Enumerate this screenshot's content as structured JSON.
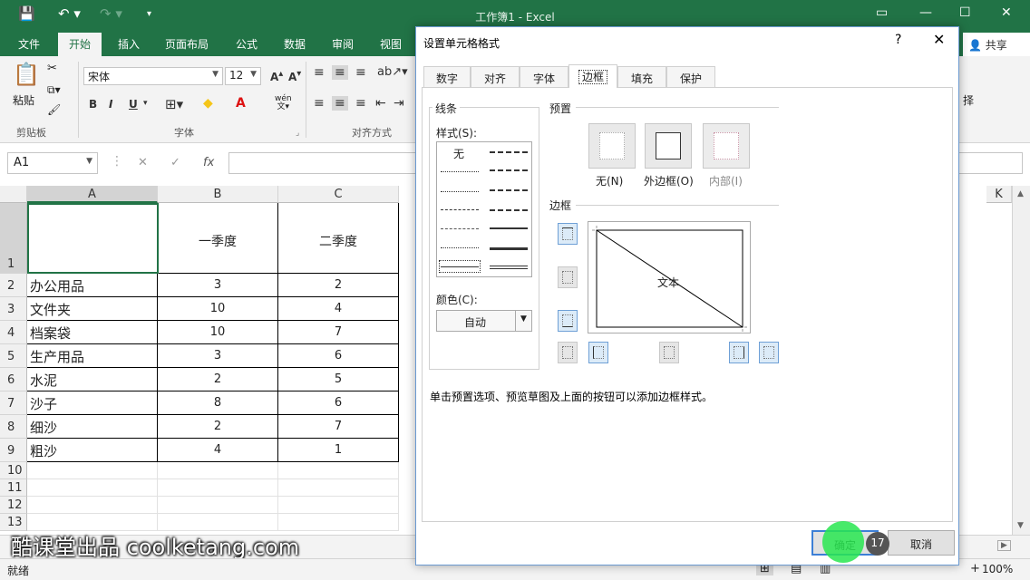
{
  "app": {
    "window_title": "工作簿1 - Excel"
  },
  "ribbon": {
    "tabs": [
      "文件",
      "开始",
      "插入",
      "页面布局",
      "公式",
      "数据",
      "审阅",
      "视图"
    ],
    "active_tab": "开始",
    "share_label": "共享",
    "font_name": "宋体",
    "font_size": "12",
    "paste_label": "粘贴",
    "group_clipboard": "剪贴板",
    "group_font": "字体",
    "group_alignment": "对齐方式",
    "partial_right_label": "择",
    "bold": "B",
    "italic": "I",
    "underline": "U",
    "wen": "wén"
  },
  "formula_bar": {
    "name_box": "A1",
    "fx": "fx",
    "cancel": "✕",
    "enter": "✓"
  },
  "sheet": {
    "columns": [
      "A",
      "B",
      "C"
    ],
    "partial_column_right": "K",
    "row_numbers": [
      "1",
      "2",
      "3",
      "4",
      "5",
      "6",
      "7",
      "8",
      "9",
      "10",
      "11",
      "12",
      "13"
    ],
    "header_row": [
      "",
      "一季度",
      "二季度"
    ],
    "rows": [
      [
        "办公用品",
        "3",
        "2"
      ],
      [
        "文件夹",
        "10",
        "4"
      ],
      [
        "档案袋",
        "10",
        "7"
      ],
      [
        "生产用品",
        "3",
        "6"
      ],
      [
        "水泥",
        "2",
        "5"
      ],
      [
        "沙子",
        "8",
        "6"
      ],
      [
        "细沙",
        "2",
        "7"
      ],
      [
        "粗沙",
        "4",
        "1"
      ]
    ]
  },
  "status_bar": {
    "status": "就绪",
    "zoom": "100%"
  },
  "watermark": "酷课堂出品 coolketang.com",
  "dialog": {
    "title": "设置单元格格式",
    "help": "?",
    "close": "✕",
    "tabs": [
      "数字",
      "对齐",
      "字体",
      "边框",
      "填充",
      "保护"
    ],
    "active_tab": "边框",
    "line_group": "线条",
    "style_label": "样式(S):",
    "none_style": "无",
    "color_label": "颜色(C):",
    "color_value": "自动",
    "preset_group": "预置",
    "presets": [
      "无(N)",
      "外边框(O)",
      "内部(I)"
    ],
    "border_group": "边框",
    "preview_text": "文本",
    "hint": "单击预置选项、预览草图及上面的按钮可以添加边框样式。",
    "ok": "确定",
    "cancel": "取消"
  },
  "step_badge": "17",
  "colors": {
    "excel_green": "#217346",
    "cursor_green": "#28e650"
  }
}
